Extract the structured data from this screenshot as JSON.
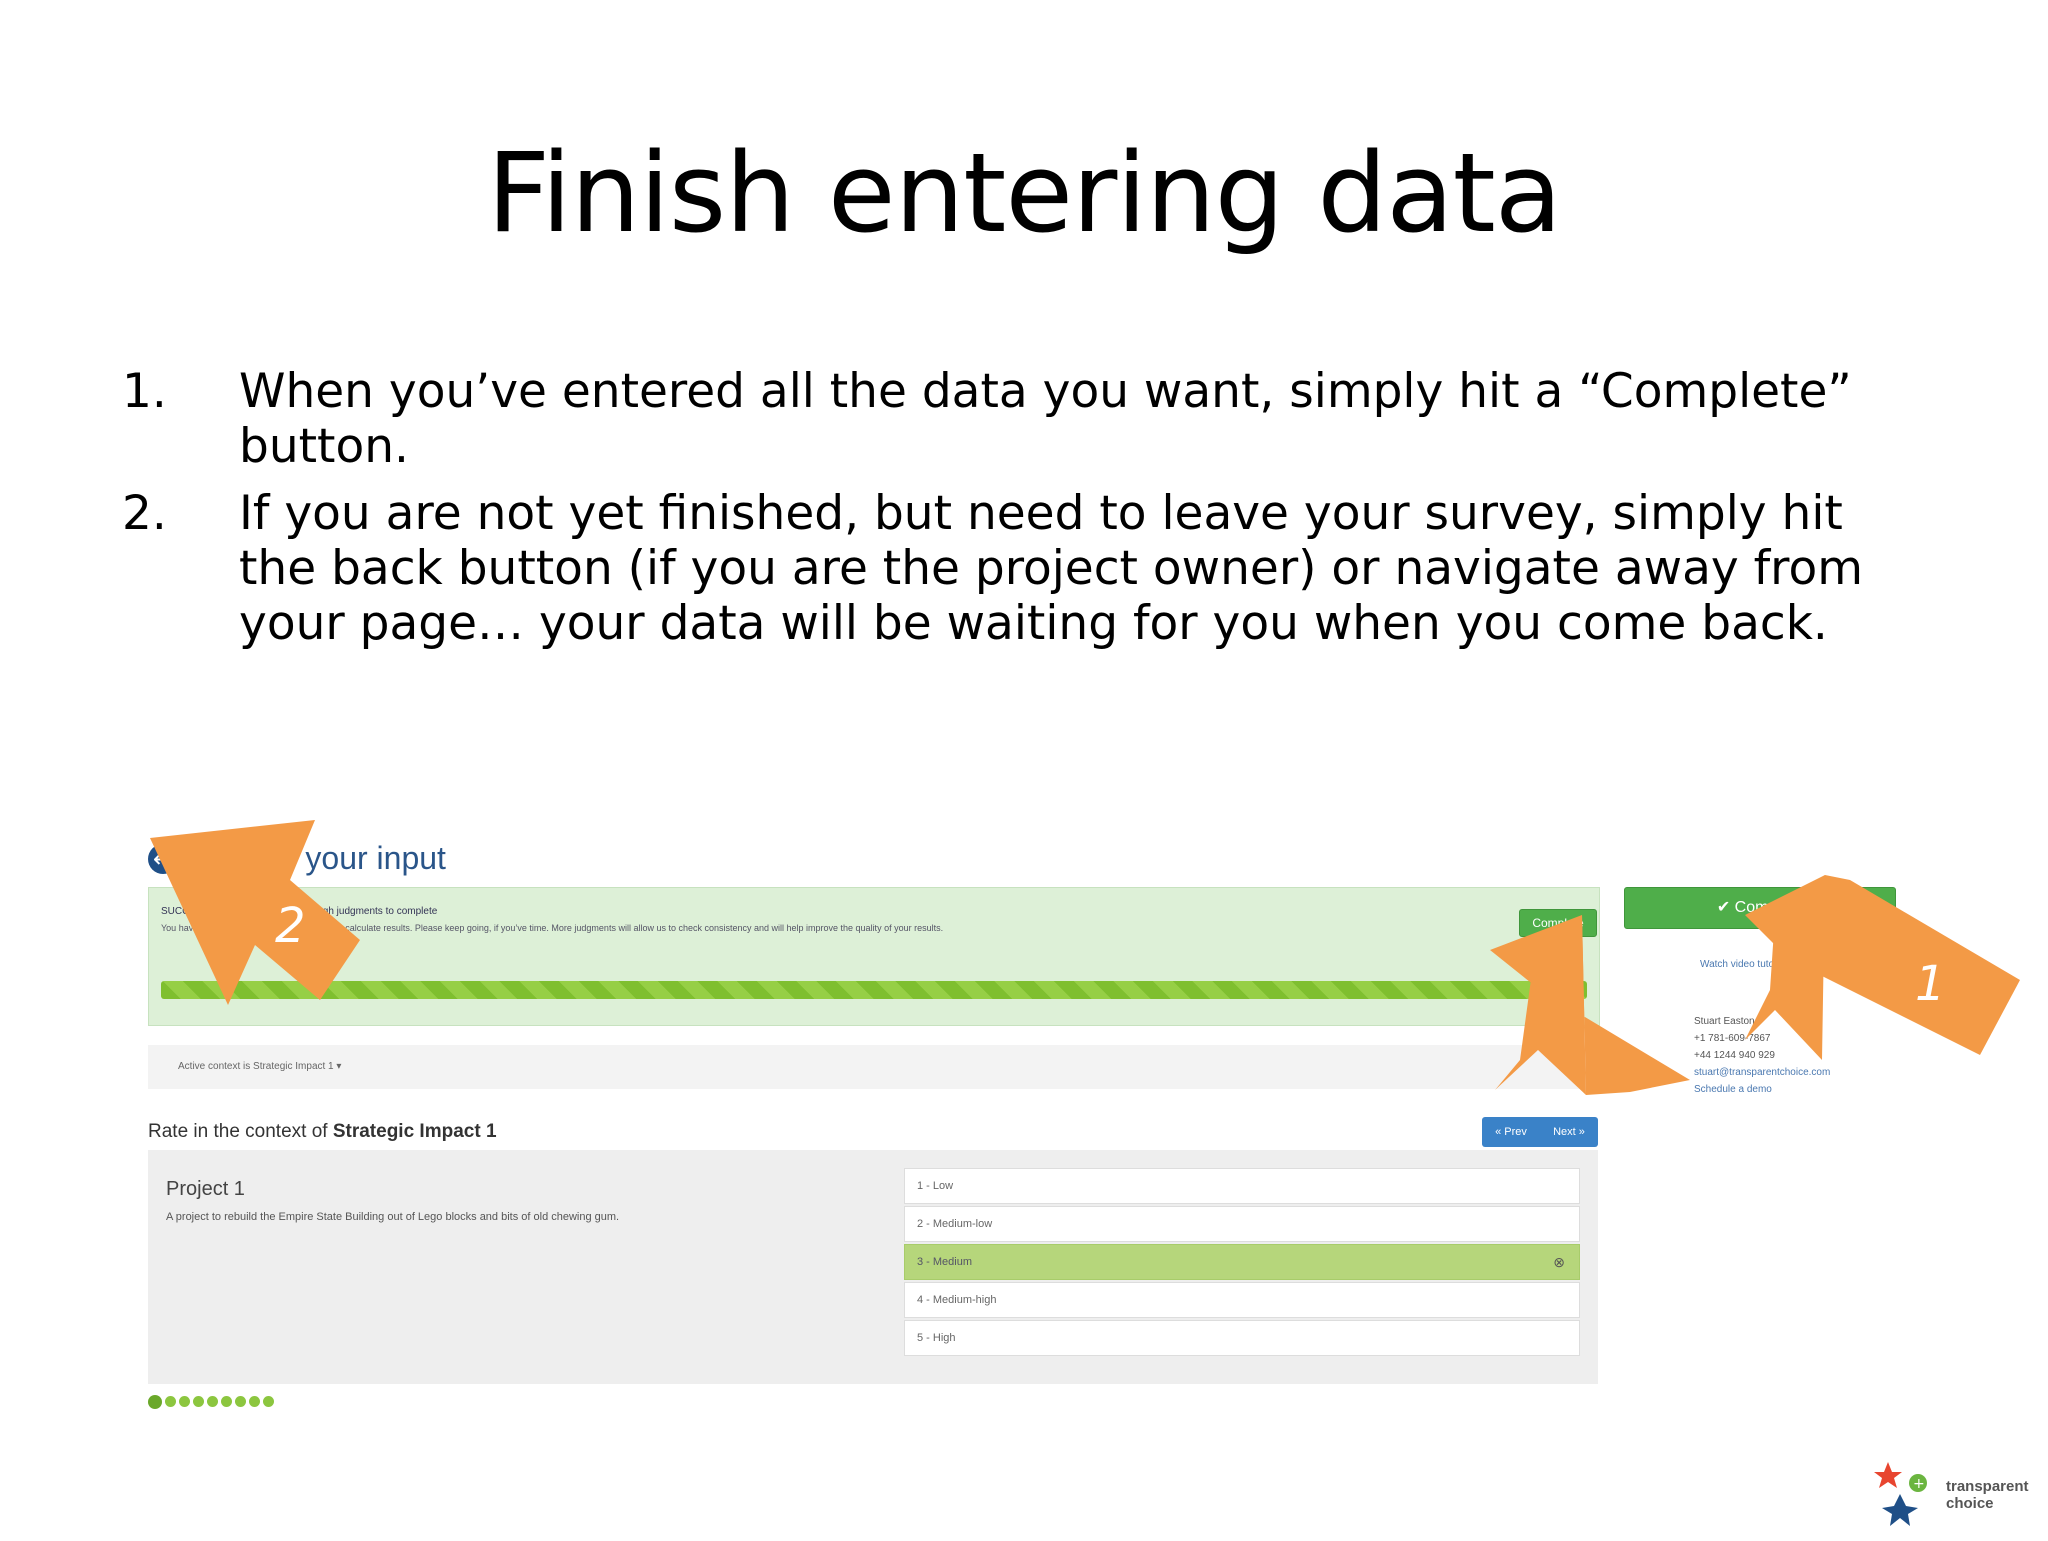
{
  "slide": {
    "title": "Finish entering data",
    "bullets": [
      {
        "num": "1.",
        "text": "When you’ve entered all the data you want, simply hit a “Complete” button."
      },
      {
        "num": "2.",
        "text": "If you are not yet finished, but need to leave your survey, simply hit the back button (if you are the project owner) or navigate away from your page… your data will be waiting for you when you come back."
      }
    ]
  },
  "screenshot": {
    "header": {
      "title": "Provide your input",
      "back_icon": "arrow-left-circle-icon"
    },
    "success": {
      "heading": "SUCCESS – you have entered enough judgments to complete",
      "body": "You have entered enough judgments for us to calculate results. Please keep going, if you’ve time. More judgments will allow us to check consistency and will help improve the quality of your results.",
      "complete_label": "Complete",
      "progress_fraction": 1.0,
      "progress_color": "#8cc63f"
    },
    "context": {
      "text": "Active context is Strategic Impact 1 ▾"
    },
    "rate": {
      "prefix": "Rate in the context of",
      "criterion": "Strategic Impact 1",
      "prev": "« Prev",
      "next": "Next »"
    },
    "project": {
      "name": "Project 1",
      "description": "A project to rebuild the Empire State Building out of Lego blocks and bits of old chewing gum.",
      "options": [
        "1 - Low",
        "2 - Medium-low",
        "3 - Medium",
        "4 - Medium-high",
        "5 - High"
      ],
      "selected_index": 2,
      "selected_color": "#b6d67b"
    },
    "dots_count": 9,
    "sidebar": {
      "complete_label": "✔ Complete",
      "link": "Watch video tutorial",
      "contact": [
        "Stuart Easton",
        "+1 781-609-7867",
        "+44 1244 940 929",
        "stuart@transparentchoice.com"
      ],
      "schedule": "Schedule a demo"
    }
  },
  "annotations": {
    "arrow_color": "#f39a46",
    "labels": [
      "2",
      "1",
      "1"
    ]
  },
  "logo": {
    "line1": "transparent",
    "line2": "choice"
  }
}
